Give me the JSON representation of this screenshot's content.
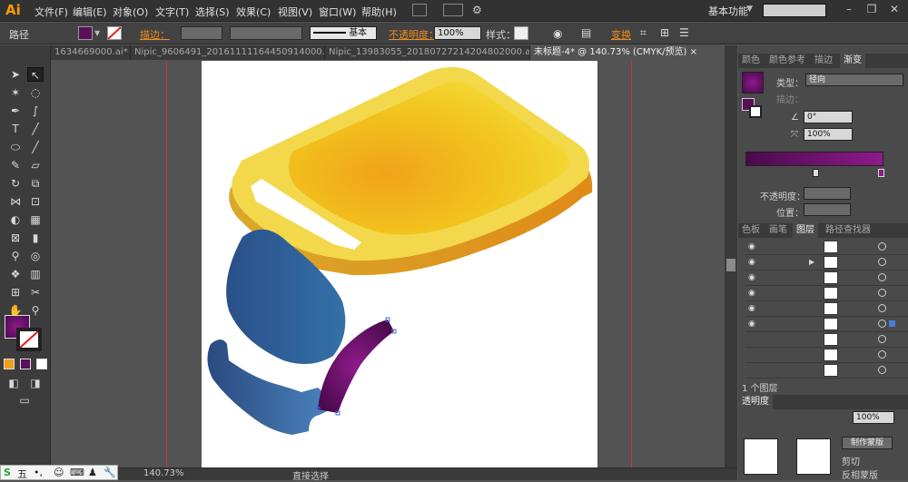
{
  "menubar": {
    "logo": "Ai",
    "items": [
      "文件(F)",
      "编辑(E)",
      "对象(O)",
      "文字(T)",
      "选择(S)",
      "效果(C)",
      "视图(V)",
      "窗口(W)",
      "帮助(H)"
    ],
    "workspace": "基本功能",
    "window_buttons": [
      "–",
      "❐",
      "✕"
    ]
  },
  "control": {
    "object_type": "路径",
    "stroke_label": "描边：",
    "stroke_style": "基本",
    "opacity_label": "不透明度：",
    "opacity_value": "100%",
    "style_label": "样式：",
    "transform_label": "变换",
    "fill_color": "#5a0e5c"
  },
  "tabs": [
    "1634669000.ai* ×",
    "Nipic_9606491_20161111164450914000.ai* ×",
    "Nipic_13983055_20180727214204802000.ai* ×",
    "未标题-4* @ 140.73% (CMYK/预览) ×"
  ],
  "right": {
    "top_tabs": [
      "颜色",
      "颜色参考",
      "描边",
      "渐变"
    ],
    "gradient": {
      "type_label": "类型：",
      "type_value": "径向",
      "stroke_label": "描边：",
      "angle_value": "0°",
      "aspect_value": "100%",
      "opacity_label": "不透明度：",
      "location_label": "位置："
    },
    "mid_tabs": [
      "色板",
      "画笔",
      "图层",
      "路径查找器"
    ],
    "layers_count": "1 个图层",
    "transparency_tab": "透明度",
    "mask_button": "制作蒙版",
    "clip_label": "剪切",
    "invert_label": "反相蒙版",
    "opacity_value": "100%"
  },
  "status": {
    "zoom": "140.73%",
    "tool": "直接选择"
  },
  "ime": {
    "label": "五"
  },
  "colors": {
    "accent_orange": "#f08c1a",
    "gradient_purple_dark": "#4a0a4c",
    "gradient_purple_light": "#8e1a8c",
    "yellow_main": "#f0c820",
    "blue_main": "#2e5a96"
  }
}
